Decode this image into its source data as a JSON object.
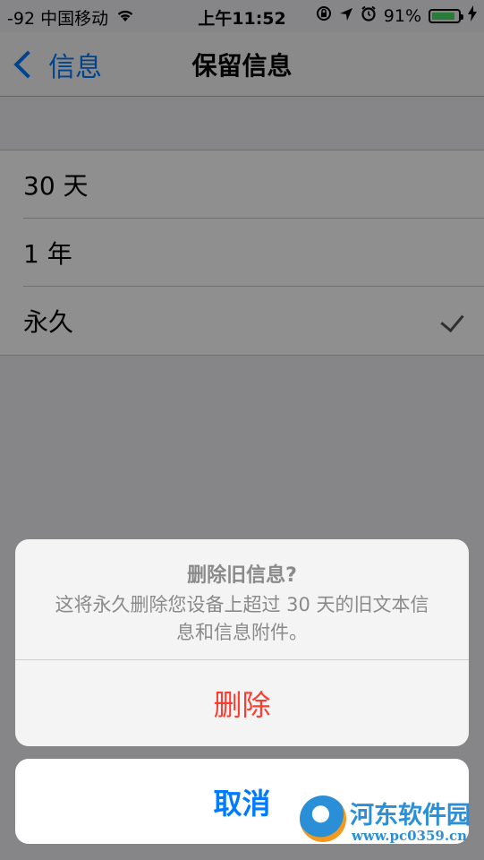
{
  "status_bar": {
    "carrier": "-92 中国移动",
    "wifi_icon": "wifi-icon",
    "time": "上午11:52",
    "battery_percent": "91%",
    "battery_level": 0.91,
    "battery_color": "#4cd964"
  },
  "nav": {
    "back_label": "信息",
    "title": "保留信息"
  },
  "options": [
    {
      "label": "30 天",
      "selected": false
    },
    {
      "label": "1 年",
      "selected": false
    },
    {
      "label": "永久",
      "selected": true
    }
  ],
  "alert": {
    "title": "删除旧信息?",
    "message_line1": "这将永久删除您设备上超过 30 天的旧文本信",
    "message_line2": "息和信息附件。",
    "destructive_label": "删除",
    "cancel_label": "取消"
  },
  "watermark": {
    "name": "河东软件园",
    "url": "www.pc0359.cn"
  },
  "colors": {
    "accent": "#007aff",
    "destructive": "#ff3b30"
  }
}
